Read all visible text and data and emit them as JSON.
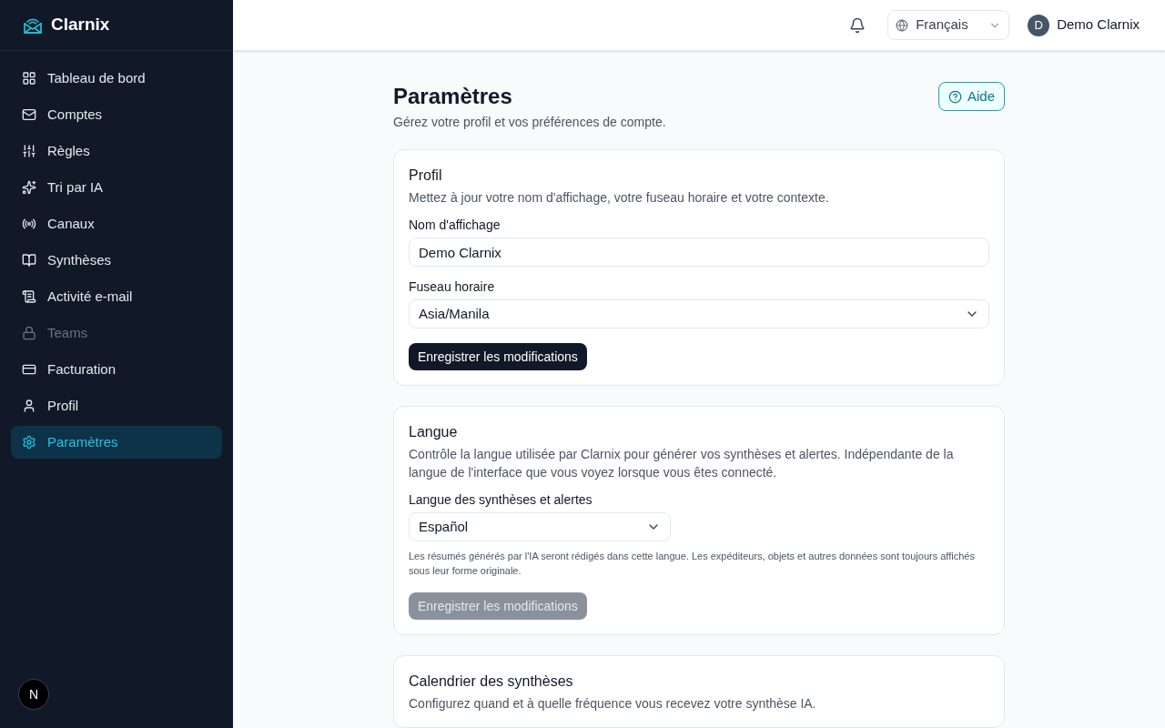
{
  "brand": {
    "name": "Clarnix"
  },
  "sidebar": {
    "items": [
      {
        "label": "Tableau de bord",
        "selected": false,
        "disabled": false
      },
      {
        "label": "Comptes",
        "selected": false,
        "disabled": false
      },
      {
        "label": "Règles",
        "selected": false,
        "disabled": false
      },
      {
        "label": "Tri par IA",
        "selected": false,
        "disabled": false
      },
      {
        "label": "Canaux",
        "selected": false,
        "disabled": false
      },
      {
        "label": "Synthèses",
        "selected": false,
        "disabled": false
      },
      {
        "label": "Activité e-mail",
        "selected": false,
        "disabled": false
      },
      {
        "label": "Teams",
        "selected": false,
        "disabled": true
      },
      {
        "label": "Facturation",
        "selected": false,
        "disabled": false
      },
      {
        "label": "Profil",
        "selected": false,
        "disabled": false
      },
      {
        "label": "Paramètres",
        "selected": true,
        "disabled": false
      }
    ],
    "footer_badge": "N"
  },
  "topbar": {
    "language": "Français",
    "user": {
      "initial": "D",
      "name": "Demo Clarnix"
    }
  },
  "page": {
    "title": "Paramètres",
    "subtitle": "Gérez votre profil et vos préférences de compte.",
    "help_button": "Aide"
  },
  "cards": [
    {
      "title": "Profil",
      "description": "Mettez à jour votre nom d'affichage, votre fuseau horaire et votre contexte.",
      "fields": [
        {
          "kind": "text",
          "label": "Nom d'affichage",
          "value": "Demo Clarnix"
        },
        {
          "kind": "select",
          "label": "Fuseau horaire",
          "value": "Asia/Manila"
        }
      ],
      "save_button": {
        "label": "Enregistrer les modifications",
        "disabled": false
      }
    },
    {
      "title": "Langue",
      "description": "Contrôle la langue utilisée par Clarnix pour générer vos synthèses et alertes. Indépendante de la langue de l'interface que vous voyez lorsque vous êtes connecté.",
      "fields": [
        {
          "kind": "select_half",
          "label": "Langue des synthèses et alertes",
          "value": "Español",
          "hint": "Les résumés générés par l'IA seront rédigés dans cette langue. Les expéditeurs, objets et autres données sont toujours affichés sous leur forme originale."
        }
      ],
      "save_button": {
        "label": "Enregistrer les modifications",
        "disabled": true
      }
    },
    {
      "title": "Calendrier des synthèses",
      "description": "Configurez quand et à quelle fréquence vous recevez votre synthèse IA."
    }
  ]
}
